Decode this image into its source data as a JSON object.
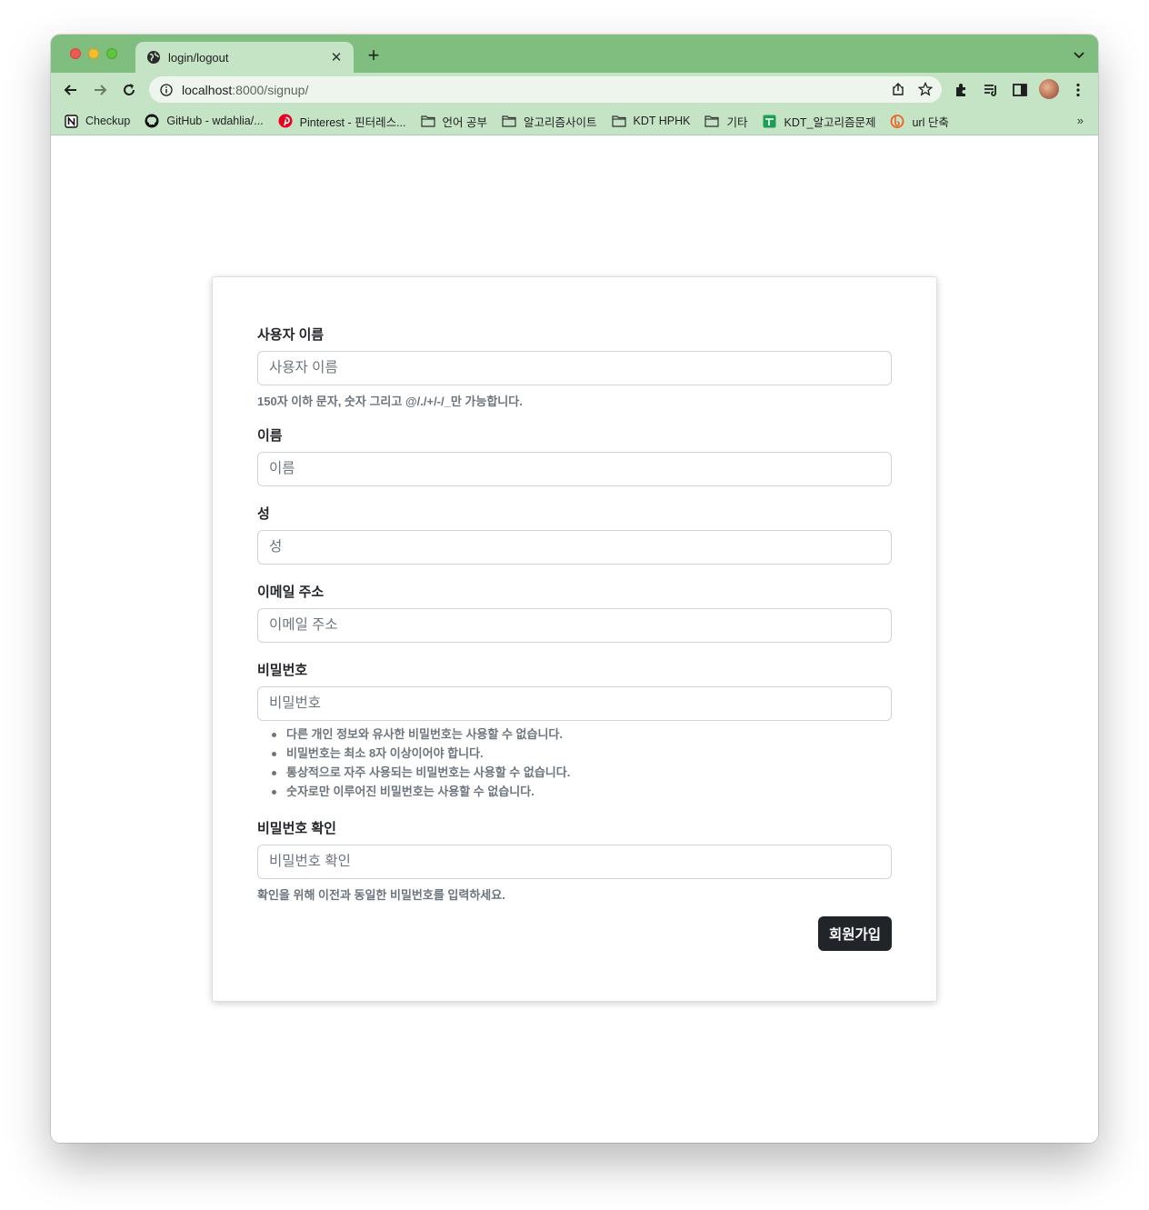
{
  "browser": {
    "tab_title": "login/logout",
    "url_host": "localhost",
    "url_path": ":8000/signup/",
    "bookmarks": [
      {
        "label": "Checkup",
        "icon": "notion-icon"
      },
      {
        "label": "GitHub - wdahlia/...",
        "icon": "github-icon"
      },
      {
        "label": "Pinterest - 핀터레스...",
        "icon": "pinterest-icon"
      },
      {
        "label": "언어 공부",
        "icon": "folder-icon"
      },
      {
        "label": "알고리즘사이트",
        "icon": "folder-icon"
      },
      {
        "label": "KDT HPHK",
        "icon": "folder-icon"
      },
      {
        "label": "기타",
        "icon": "folder-icon"
      },
      {
        "label": "KDT_알고리즘문제",
        "icon": "sheets-icon"
      },
      {
        "label": "url 단축",
        "icon": "bitly-icon"
      }
    ],
    "bookmarks_more": "»"
  },
  "form": {
    "username": {
      "label": "사용자 이름",
      "placeholder": "사용자 이름",
      "help": "150자 이하 문자, 숫자 그리고 @/./+/-/_만 가능합니다."
    },
    "first_name": {
      "label": "이름",
      "placeholder": "이름"
    },
    "last_name": {
      "label": "성",
      "placeholder": "성"
    },
    "email": {
      "label": "이메일 주소",
      "placeholder": "이메일 주소"
    },
    "password1": {
      "label": "비밀번호",
      "placeholder": "비밀번호",
      "help_items": [
        "다른 개인 정보와 유사한 비밀번호는 사용할 수 없습니다.",
        "비밀번호는 최소 8자 이상이어야 합니다.",
        "통상적으로 자주 사용되는 비밀번호는 사용할 수 없습니다.",
        "숫자로만 이루어진 비밀번호는 사용할 수 없습니다."
      ]
    },
    "password2": {
      "label": "비밀번호 확인",
      "placeholder": "비밀번호 확인",
      "help": "확인을 위해 이전과 동일한 비밀번호를 입력하세요."
    },
    "submit_label": "회원가입"
  },
  "colors": {
    "tabstrip": "#7fbe7e",
    "toolbar": "#c5e3c5",
    "button_bg": "#212529",
    "help_text": "#6c757d"
  }
}
